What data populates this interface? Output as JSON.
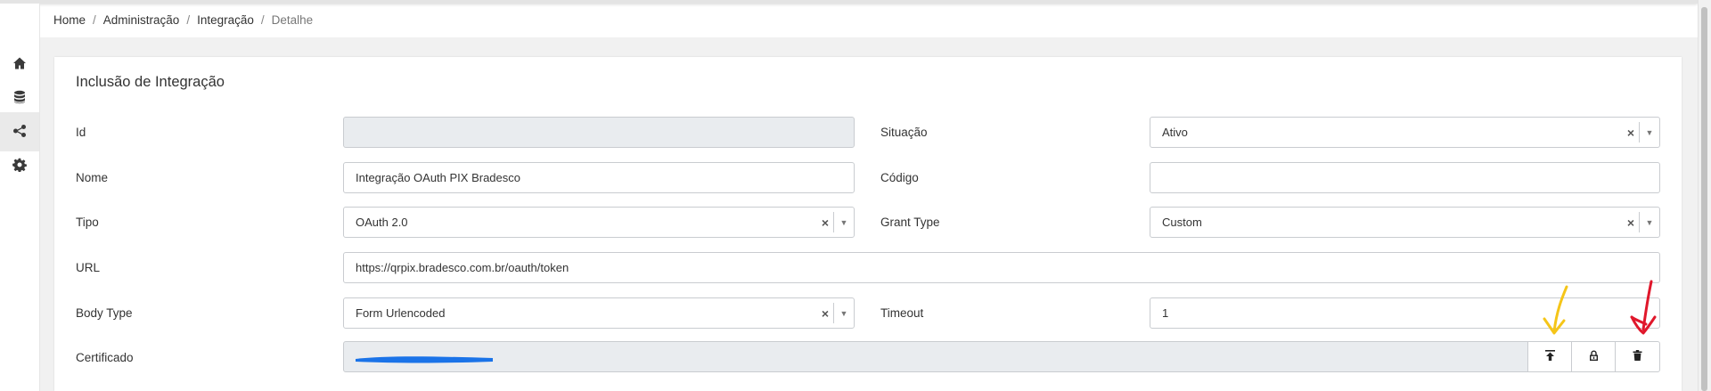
{
  "breadcrumb": {
    "home": "Home",
    "admin": "Administração",
    "integration": "Integração",
    "current": "Detalhe",
    "separator": "/"
  },
  "sidebar": {
    "items": [
      {
        "icon": "home-icon"
      },
      {
        "icon": "database-icon"
      },
      {
        "icon": "share-icon",
        "active": true
      },
      {
        "icon": "gear-icon"
      }
    ]
  },
  "form": {
    "title": "Inclusão de Integração",
    "id": {
      "label": "Id",
      "value": ""
    },
    "situacao": {
      "label": "Situação",
      "value": "Ativo"
    },
    "nome": {
      "label": "Nome",
      "value": "Integração OAuth PIX Bradesco"
    },
    "codigo": {
      "label": "Código",
      "value": ""
    },
    "tipo": {
      "label": "Tipo",
      "value": "OAuth 2.0"
    },
    "grant_type": {
      "label": "Grant Type",
      "value": "Custom"
    },
    "url": {
      "label": "URL",
      "value": "https://qrpix.bradesco.com.br/oauth/token"
    },
    "body_type": {
      "label": "Body Type",
      "value": "Form Urlencoded"
    },
    "timeout": {
      "label": "Timeout",
      "value": "1"
    },
    "certificado": {
      "label": "Certificado",
      "value": ""
    }
  },
  "select_controls": {
    "clear_symbol": "×",
    "arrow_symbol": "▼"
  },
  "annotation_colors": {
    "upload_arrow": "#f5c518",
    "delete_arrow": "#e0172b",
    "redaction": "#1a73e8"
  }
}
